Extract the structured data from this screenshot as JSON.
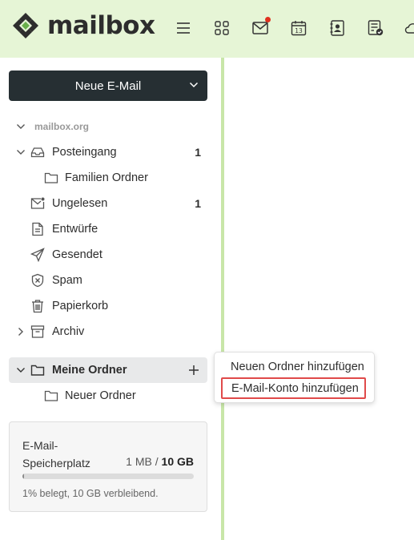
{
  "app": {
    "logo_text": "mailbox",
    "brand_color": "#6ab04c",
    "accent_bg": "#e6f5d6"
  },
  "toolbar": {
    "icons": [
      "hamburger-menu-icon",
      "apps-grid-icon",
      "mail-icon",
      "calendar-icon",
      "contacts-icon",
      "tasks-icon",
      "cloud-icon"
    ],
    "calendar_day": "13"
  },
  "sidebar": {
    "compose_label": "Neue E-Mail",
    "account": "mailbox.org",
    "folders": [
      {
        "label": "Posteingang",
        "count": "1",
        "icon": "inbox-icon"
      },
      {
        "label": "Familien Ordner",
        "count": "",
        "icon": "folder-icon"
      },
      {
        "label": "Ungelesen",
        "count": "1",
        "icon": "unread-mail-icon"
      },
      {
        "label": "Entwürfe",
        "count": "",
        "icon": "drafts-icon"
      },
      {
        "label": "Gesendet",
        "count": "",
        "icon": "sent-icon"
      },
      {
        "label": "Spam",
        "count": "",
        "icon": "spam-shield-icon"
      },
      {
        "label": "Papierkorb",
        "count": "",
        "icon": "trash-icon"
      },
      {
        "label": "Archiv",
        "count": "",
        "icon": "archive-icon"
      }
    ],
    "my_folders": {
      "label": "Meine Ordner",
      "children": [
        {
          "label": "Neuer Ordner",
          "icon": "folder-icon"
        }
      ]
    }
  },
  "storage": {
    "title": "E-Mail-Speicherplatz",
    "used": "1 MB",
    "separator": " / ",
    "total": "10 GB",
    "used_fraction": 0.01,
    "note": "1% belegt, 10 GB verbleibend."
  },
  "context_menu": {
    "items": [
      {
        "label": "Neuen Ordner hinzufügen"
      },
      {
        "label": "E-Mail-Konto hinzufügen",
        "highlighted": true
      }
    ]
  }
}
